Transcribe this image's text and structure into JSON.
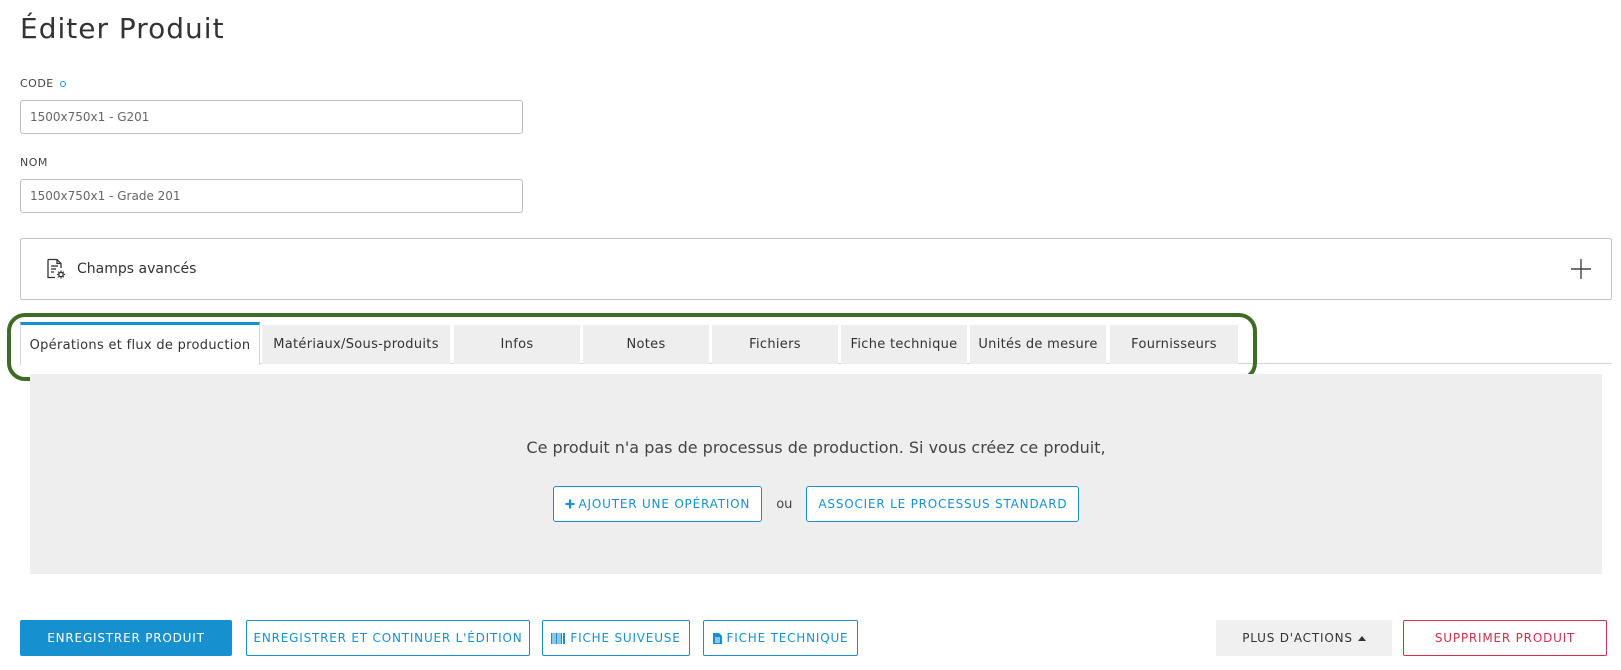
{
  "page": {
    "title": "Éditer Produit"
  },
  "form": {
    "code": {
      "label": "CODE",
      "value": "1500x750x1 - G201"
    },
    "nom": {
      "label": "NOM",
      "value": "1500x750x1 - Grade 201"
    }
  },
  "advanced": {
    "label": "Champs avancés"
  },
  "tabs": [
    {
      "label": "Opérations et flux de production",
      "active": true
    },
    {
      "label": "Matériaux/Sous-produits"
    },
    {
      "label": "Infos"
    },
    {
      "label": "Notes"
    },
    {
      "label": "Fichiers"
    },
    {
      "label": "Fiche technique"
    },
    {
      "label": "Unités de mesure"
    },
    {
      "label": "Fournisseurs"
    }
  ],
  "content": {
    "message": "Ce produit n'a pas de processus de production. Si vous créez ce produit,",
    "add_operation": "AJOUTER UNE OPÉRATION",
    "or": "ou",
    "associate_standard": "ASSOCIER LE PROCESSUS STANDARD"
  },
  "footer": {
    "save": "ENREGISTRER PRODUIT",
    "save_continue": "ENREGISTRER ET CONTINUER L'ÉDITION",
    "tracking_sheet": "FICHE SUIVEUSE",
    "technical_sheet": "FICHE TECHNIQUE",
    "more_actions": "PLUS D'ACTIONS",
    "delete": "SUPPRIMER PRODUIT"
  },
  "colors": {
    "accent": "#1790d0",
    "danger": "#d0304a",
    "highlight": "#3e6b26",
    "panel": "#eeeeee"
  },
  "icons": {
    "advanced": "settings-document-icon",
    "expand": "plus-icon",
    "add": "plus-icon",
    "tracking_sheet": "barcode-icon",
    "technical_sheet": "file-icon",
    "more_actions": "caret-up-icon"
  }
}
